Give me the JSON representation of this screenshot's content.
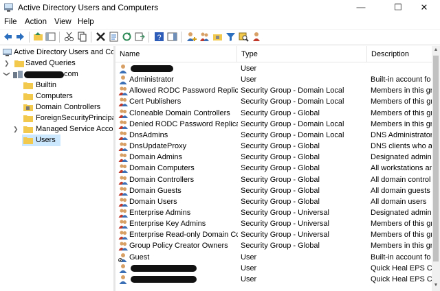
{
  "window": {
    "title": "Active Directory Users and Computers",
    "minimize": "—",
    "maximize": "☐",
    "close": "✕"
  },
  "menu": [
    "File",
    "Action",
    "View",
    "Help"
  ],
  "tree": [
    {
      "label": "Active Directory Users and Com",
      "icon": "ad-console-icon"
    },
    {
      "label": "Saved Queries",
      "icon": "folder-icon"
    },
    {
      "label": ".com",
      "icon": "domain-icon"
    },
    {
      "label": "Builtin",
      "icon": "folder-icon"
    },
    {
      "label": "Computers",
      "icon": "folder-icon"
    },
    {
      "label": "Domain Controllers",
      "icon": "ou-folder-icon"
    },
    {
      "label": "ForeignSecurityPrincipals",
      "icon": "folder-icon"
    },
    {
      "label": "Managed Service Accour",
      "icon": "folder-icon"
    },
    {
      "label": "Users",
      "icon": "folder-icon"
    }
  ],
  "columns": {
    "name": "Name",
    "type": "Type",
    "description": "Description"
  },
  "rows": [
    {
      "name": "",
      "type": "User",
      "desc": "",
      "icon": "user-icon"
    },
    {
      "name": "Administrator",
      "type": "User",
      "desc": "Built-in account fo",
      "icon": "user-icon"
    },
    {
      "name": "Allowed RODC Password Replica...",
      "type": "Security Group - Domain Local",
      "desc": "Members in this gr",
      "icon": "group-icon"
    },
    {
      "name": "Cert Publishers",
      "type": "Security Group - Domain Local",
      "desc": "Members of this gr",
      "icon": "group-icon"
    },
    {
      "name": "Cloneable Domain Controllers",
      "type": "Security Group - Global",
      "desc": "Members of this gr",
      "icon": "group-icon"
    },
    {
      "name": "Denied RODC Password Replicati...",
      "type": "Security Group - Domain Local",
      "desc": "Members in this gr",
      "icon": "group-icon"
    },
    {
      "name": "DnsAdmins",
      "type": "Security Group - Domain Local",
      "desc": "DNS Administrator",
      "icon": "group-icon"
    },
    {
      "name": "DnsUpdateProxy",
      "type": "Security Group - Global",
      "desc": "DNS clients who ar",
      "icon": "group-icon"
    },
    {
      "name": "Domain Admins",
      "type": "Security Group - Global",
      "desc": "Designated admini",
      "icon": "group-icon"
    },
    {
      "name": "Domain Computers",
      "type": "Security Group - Global",
      "desc": "All workstations an",
      "icon": "group-icon"
    },
    {
      "name": "Domain Controllers",
      "type": "Security Group - Global",
      "desc": "All domain control",
      "icon": "group-icon"
    },
    {
      "name": "Domain Guests",
      "type": "Security Group - Global",
      "desc": "All domain guests",
      "icon": "group-icon"
    },
    {
      "name": "Domain Users",
      "type": "Security Group - Global",
      "desc": "All domain users",
      "icon": "group-icon"
    },
    {
      "name": "Enterprise Admins",
      "type": "Security Group - Universal",
      "desc": "Designated admini",
      "icon": "group-icon"
    },
    {
      "name": "Enterprise Key Admins",
      "type": "Security Group - Universal",
      "desc": "Members of this gr",
      "icon": "group-icon"
    },
    {
      "name": "Enterprise Read-only Domain Co...",
      "type": "Security Group - Universal",
      "desc": "Members of this gr",
      "icon": "group-icon"
    },
    {
      "name": "Group Policy Creator Owners",
      "type": "Security Group - Global",
      "desc": "Members in this gr",
      "icon": "group-icon"
    },
    {
      "name": "Guest",
      "type": "User",
      "desc": "Built-in account fo",
      "icon": "user-disabled-icon"
    },
    {
      "name": "",
      "type": "User",
      "desc": "Quick Heal EPS Co",
      "icon": "user-icon"
    },
    {
      "name": "",
      "type": "User",
      "desc": "Quick Heal EPS Co",
      "icon": "user-icon"
    }
  ],
  "colors": {
    "user_head": "#d9a066",
    "user_body": "#3b6fb6",
    "group_body": "#c0392b",
    "folder": "#f2c94c"
  }
}
